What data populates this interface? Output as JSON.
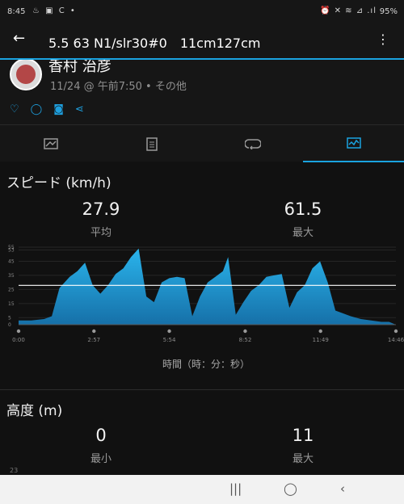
{
  "status_bar": {
    "time": "8:45",
    "left_icons": "♨ ▣ C •",
    "right_icons": "⏰ ✕ ≋ ⊿ .ıl",
    "battery": "95%"
  },
  "app_bar": {
    "back_icon": "arrow-left-icon",
    "title": "5.5 63 N1/slr30#0　11cm127cm",
    "menu_icon": "more-vert-icon"
  },
  "profile": {
    "name": "香村 治彦",
    "meta": "11/24 @ 午前7:50 • その他"
  },
  "social_icons": [
    "heart-icon",
    "comment-icon",
    "camera-icon",
    "share-icon"
  ],
  "tabs": [
    {
      "name": "map-tab",
      "icon": "map-icon"
    },
    {
      "name": "details-tab",
      "icon": "document-icon"
    },
    {
      "name": "laps-tab",
      "icon": "loop-icon"
    },
    {
      "name": "charts-tab",
      "icon": "chart-icon",
      "active": true
    }
  ],
  "speed": {
    "title": "スピード (km/h)",
    "avg_value": "27.9",
    "avg_label": "平均",
    "max_value": "61.5",
    "max_label": "最大"
  },
  "elevation": {
    "title": "高度 (m)",
    "min_value": "0",
    "min_label": "最小",
    "max_value": "11",
    "max_label": "最大",
    "next_tick": "23"
  },
  "accent_color": "#1aa3e0",
  "chart_data": {
    "type": "area",
    "title": "スピード (km/h)",
    "xlabel": "時間（時：分：秒）",
    "ylabel": "",
    "y_ticks": [
      "55",
      "53",
      "45",
      "35",
      "25",
      "15",
      "5",
      "0"
    ],
    "x_ticks": [
      "0:00",
      "2:57",
      "5:54",
      "8:52",
      "11:49",
      "14:46"
    ],
    "ylim": [
      0,
      55
    ],
    "xlim_minutes": [
      0,
      14.77
    ],
    "average": 27.9,
    "series": [
      {
        "x_minutes": [
          0,
          0.5,
          1,
          1.3,
          1.6,
          2.0,
          2.3,
          2.6,
          2.9,
          3.2,
          3.5,
          3.8,
          4.1,
          4.4,
          4.7,
          5.0,
          5.3,
          5.6,
          5.9,
          6.2,
          6.5,
          6.8,
          7.1,
          7.4,
          7.7,
          8.0,
          8.2,
          8.5,
          8.8,
          9.1,
          9.4,
          9.7,
          10.0,
          10.3,
          10.6,
          10.9,
          11.2,
          11.5,
          11.8,
          12.1,
          12.4,
          12.7,
          13.0,
          13.4,
          13.8,
          14.2,
          14.5,
          14.77
        ],
        "values": [
          3,
          3,
          4,
          6,
          26,
          34,
          38,
          44,
          28,
          22,
          28,
          36,
          40,
          48,
          54,
          20,
          16,
          30,
          33,
          34,
          33,
          6,
          20,
          30,
          34,
          38,
          48,
          7,
          16,
          24,
          28,
          34,
          35,
          36,
          12,
          23,
          28,
          40,
          45,
          30,
          10,
          8,
          6,
          4,
          3,
          2,
          2,
          0
        ]
      }
    ]
  },
  "nav_bar": {
    "recents_icon": "|||",
    "home_icon": "◯",
    "back_icon": "‹"
  }
}
